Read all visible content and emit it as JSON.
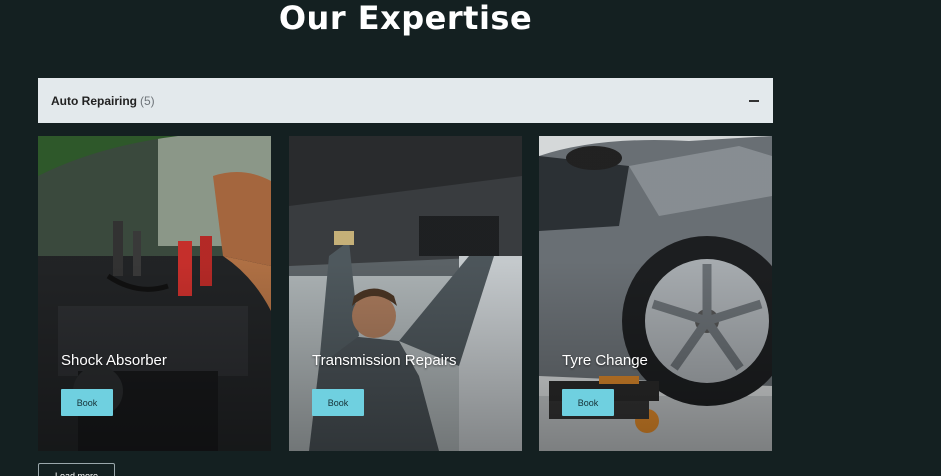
{
  "section": {
    "title": "Our Expertise"
  },
  "accordion": {
    "title": "Auto Repairing",
    "count": "(5)",
    "toggle_symbol": "minus-icon"
  },
  "cards": [
    {
      "title": "Shock Absorber",
      "button_label": "Book",
      "image": "engine-battery-cables-photo"
    },
    {
      "title": "Transmission Repairs",
      "button_label": "Book",
      "image": "mechanic-under-car-photo"
    },
    {
      "title": "Tyre Change",
      "button_label": "Book",
      "image": "car-wheel-tyre-photo"
    }
  ],
  "load_more": {
    "label": "Load more"
  },
  "colors": {
    "background": "#142021",
    "accordion_bg": "#e3e9ec",
    "button_accent": "#6fd0e0"
  }
}
